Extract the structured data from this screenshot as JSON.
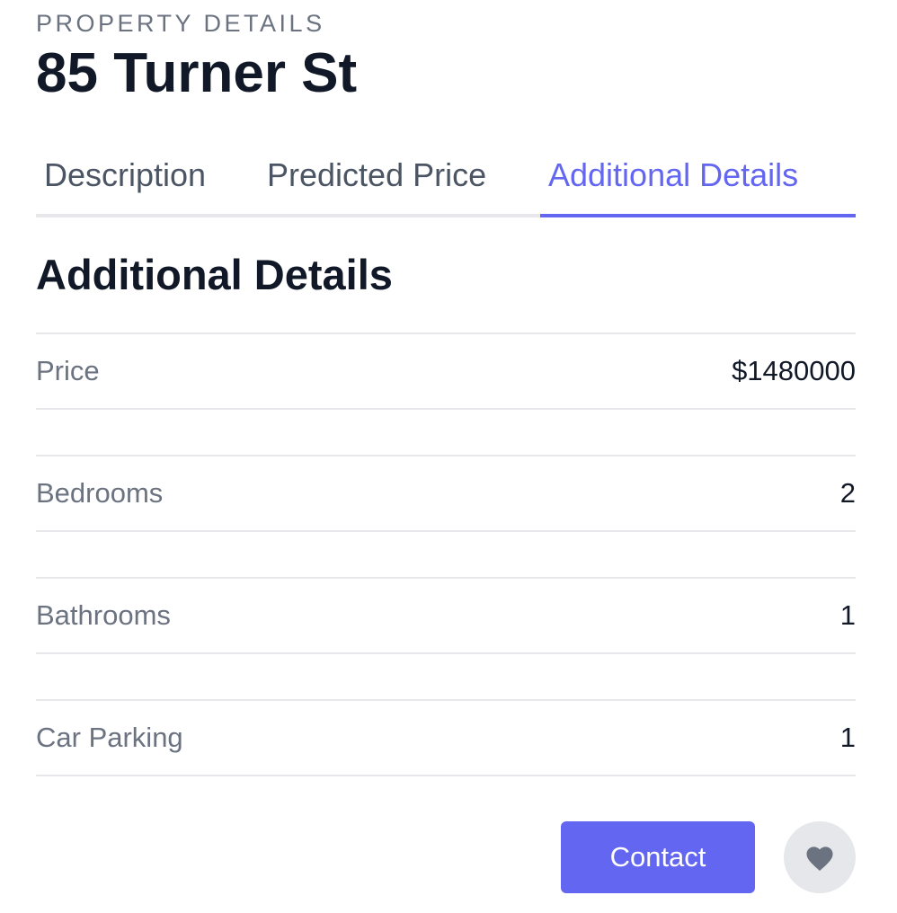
{
  "header": {
    "eyebrow": "PROPERTY DETAILS",
    "title": "85 Turner St"
  },
  "tabs": [
    {
      "label": "Description",
      "active": false
    },
    {
      "label": "Predicted Price",
      "active": false
    },
    {
      "label": "Additional Details",
      "active": true
    }
  ],
  "section": {
    "title": "Additional Details"
  },
  "details": [
    {
      "label": "Price",
      "value": "$1480000"
    },
    {
      "label": "Bedrooms",
      "value": "2"
    },
    {
      "label": "Bathrooms",
      "value": "1"
    },
    {
      "label": "Car Parking",
      "value": "1"
    }
  ],
  "actions": {
    "contact_label": "Contact",
    "favorite_icon": "heart-icon"
  },
  "colors": {
    "accent": "#6366f1",
    "text_primary": "#111827",
    "text_muted": "#6b7280",
    "divider": "#e5e7eb"
  }
}
